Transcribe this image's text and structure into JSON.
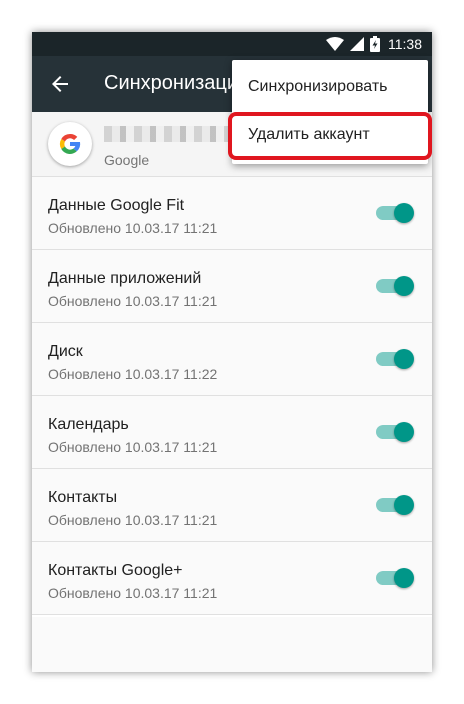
{
  "status_bar": {
    "time": "11:38"
  },
  "app_bar": {
    "title": "Синхронизация"
  },
  "account": {
    "type": "Google"
  },
  "menu": {
    "items": [
      {
        "label": "Синхронизировать"
      },
      {
        "label": "Удалить аккаунт"
      }
    ]
  },
  "sync_items": [
    {
      "title": "Данные Google Fit",
      "updated": "Обновлено 10.03.17 11:21",
      "enabled": true
    },
    {
      "title": "Данные приложений",
      "updated": "Обновлено 10.03.17 11:21",
      "enabled": true
    },
    {
      "title": "Диск",
      "updated": "Обновлено 10.03.17 11:22",
      "enabled": true
    },
    {
      "title": "Календарь",
      "updated": "Обновлено 10.03.17 11:21",
      "enabled": true
    },
    {
      "title": "Контакты",
      "updated": "Обновлено 10.03.17 11:21",
      "enabled": true
    },
    {
      "title": "Контакты Google+",
      "updated": "Обновлено 10.03.17 11:21",
      "enabled": true
    }
  ],
  "colors": {
    "toolbar": "#263238",
    "status_bar": "#1b2529",
    "toggle_thumb": "#009688",
    "toggle_track": "#80cbc4",
    "highlight": "#e0161f"
  },
  "icons": {
    "back": "arrow-left-icon",
    "wifi": "wifi-icon",
    "signal": "cell-signal-icon",
    "battery": "battery-charging-icon",
    "account": "google-logo-icon"
  }
}
